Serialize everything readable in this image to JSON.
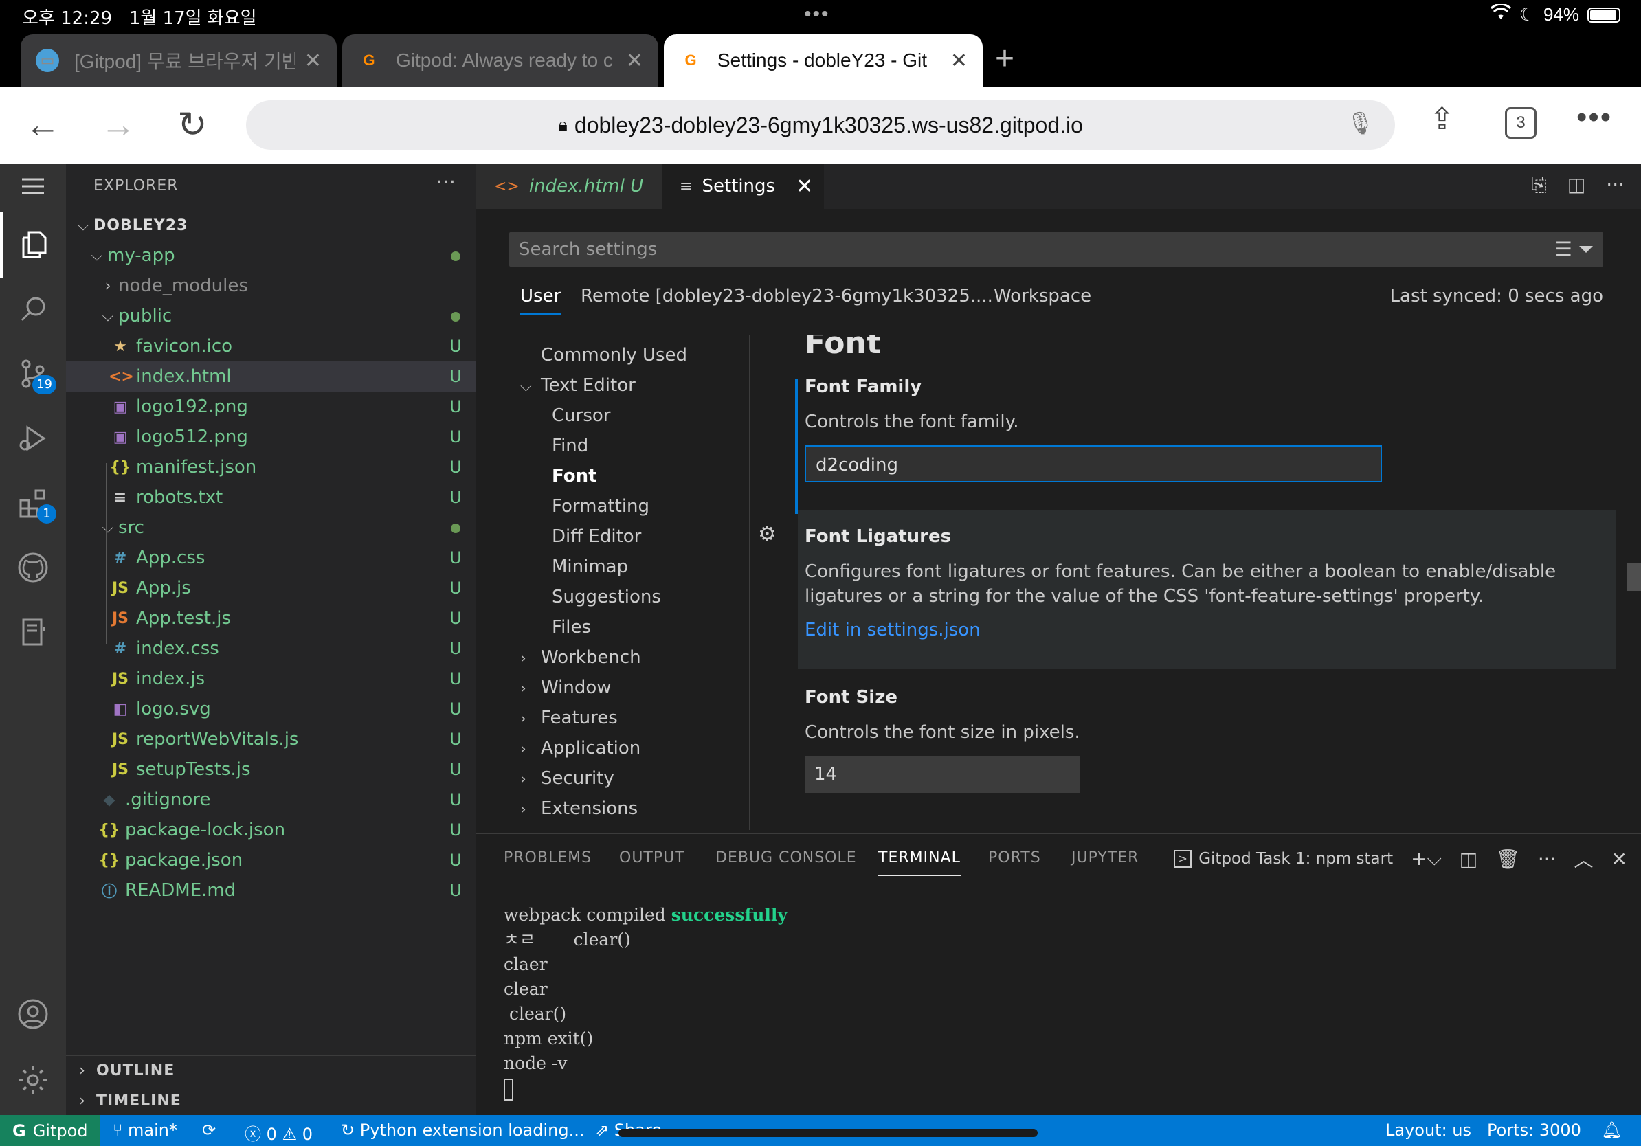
{
  "status_bar": {
    "time": "오후 12:29",
    "date": "1월 17일 화요일",
    "battery": "94%",
    "battery_level": 0.94
  },
  "browser": {
    "tabs": [
      {
        "label": "[Gitpod] 무료 브라우저 기반",
        "icon": "gitpod-monitor-icon",
        "active": false
      },
      {
        "label": "Gitpod: Always ready to c",
        "icon": "gitpod-logo-icon",
        "active": false
      },
      {
        "label": "Settings - dobleY23 - Git",
        "icon": "gitpod-logo-icon",
        "active": true
      }
    ],
    "url": "dobley23-dobley23-6gmy1k30325.ws-us82.gitpod.io",
    "tab_count": "3"
  },
  "explorer": {
    "title": "EXPLORER",
    "root": "DOBLEY23",
    "rows": [
      {
        "name": "my-app",
        "kind": "folder-open",
        "icon": "",
        "status": "dot",
        "color": "green",
        "indent": 1
      },
      {
        "name": "node_modules",
        "kind": "folder-closed",
        "icon": "",
        "status": "",
        "color": "grey",
        "indent": 2
      },
      {
        "name": "public",
        "kind": "folder-open",
        "icon": "",
        "status": "dot",
        "color": "green",
        "indent": 2
      },
      {
        "name": "favicon.ico",
        "kind": "file",
        "icon": "★",
        "iconColor": "#e5c07b",
        "status": "U",
        "color": "green",
        "indent": 3
      },
      {
        "name": "index.html",
        "kind": "file",
        "icon": "<>",
        "iconColor": "#e37933",
        "status": "U",
        "color": "green",
        "indent": 3,
        "selected": true
      },
      {
        "name": "logo192.png",
        "kind": "file",
        "icon": "▣",
        "iconColor": "#a074c4",
        "status": "U",
        "color": "green",
        "indent": 3
      },
      {
        "name": "logo512.png",
        "kind": "file",
        "icon": "▣",
        "iconColor": "#a074c4",
        "status": "U",
        "color": "green",
        "indent": 3
      },
      {
        "name": "manifest.json",
        "kind": "file",
        "icon": "{}",
        "iconColor": "#cbcb41",
        "status": "U",
        "color": "green",
        "indent": 3
      },
      {
        "name": "robots.txt",
        "kind": "file",
        "icon": "≡",
        "iconColor": "#cccccc",
        "status": "U",
        "color": "green",
        "indent": 3
      },
      {
        "name": "src",
        "kind": "folder-open",
        "icon": "",
        "status": "dot",
        "color": "green",
        "indent": 2
      },
      {
        "name": "App.css",
        "kind": "file",
        "icon": "#",
        "iconColor": "#519aba",
        "status": "U",
        "color": "green",
        "indent": 3
      },
      {
        "name": "App.js",
        "kind": "file",
        "icon": "JS",
        "iconColor": "#cbcb41",
        "status": "U",
        "color": "green",
        "indent": 3
      },
      {
        "name": "App.test.js",
        "kind": "file",
        "icon": "JS",
        "iconColor": "#e37933",
        "status": "U",
        "color": "green",
        "indent": 3
      },
      {
        "name": "index.css",
        "kind": "file",
        "icon": "#",
        "iconColor": "#519aba",
        "status": "U",
        "color": "green",
        "indent": 3
      },
      {
        "name": "index.js",
        "kind": "file",
        "icon": "JS",
        "iconColor": "#cbcb41",
        "status": "U",
        "color": "green",
        "indent": 3
      },
      {
        "name": "logo.svg",
        "kind": "file",
        "icon": "◧",
        "iconColor": "#a074c4",
        "status": "U",
        "color": "green",
        "indent": 3
      },
      {
        "name": "reportWebVitals.js",
        "kind": "file",
        "icon": "JS",
        "iconColor": "#cbcb41",
        "status": "U",
        "color": "green",
        "indent": 3
      },
      {
        "name": "setupTests.js",
        "kind": "file",
        "icon": "JS",
        "iconColor": "#cbcb41",
        "status": "U",
        "color": "green",
        "indent": 3
      },
      {
        "name": ".gitignore",
        "kind": "file",
        "icon": "◆",
        "iconColor": "#41535b",
        "status": "U",
        "color": "green",
        "indent": 2
      },
      {
        "name": "package-lock.json",
        "kind": "file",
        "icon": "{}",
        "iconColor": "#cbcb41",
        "status": "U",
        "color": "green",
        "indent": 2
      },
      {
        "name": "package.json",
        "kind": "file",
        "icon": "{}",
        "iconColor": "#cbcb41",
        "status": "U",
        "color": "green",
        "indent": 2
      },
      {
        "name": "README.md",
        "kind": "file",
        "icon": "ⓘ",
        "iconColor": "#519aba",
        "status": "U",
        "color": "green",
        "indent": 2
      }
    ],
    "outline": "OUTLINE",
    "timeline": "TIMELINE"
  },
  "activity_badges": {
    "scm": "19",
    "extensions": "1"
  },
  "editor_tabs": [
    {
      "label": "index.html",
      "suffix": "U"
    },
    {
      "label": "Settings"
    }
  ],
  "settings": {
    "search_placeholder": "Search settings",
    "scope_tabs": [
      "User",
      "Remote [dobley23-dobley23-6gmy1k30325....",
      "Workspace"
    ],
    "last_synced": "Last synced: 0 secs ago",
    "toc": [
      {
        "label": "Commonly Used",
        "level": 0,
        "chev": ""
      },
      {
        "label": "Text Editor",
        "level": 0,
        "chev": "open"
      },
      {
        "label": "Cursor",
        "level": 1,
        "chev": ""
      },
      {
        "label": "Find",
        "level": 1,
        "chev": ""
      },
      {
        "label": "Font",
        "level": 1,
        "chev": "",
        "bold": true
      },
      {
        "label": "Formatting",
        "level": 1,
        "chev": ""
      },
      {
        "label": "Diff Editor",
        "level": 1,
        "chev": ""
      },
      {
        "label": "Minimap",
        "level": 1,
        "chev": ""
      },
      {
        "label": "Suggestions",
        "level": 1,
        "chev": ""
      },
      {
        "label": "Files",
        "level": 1,
        "chev": ""
      },
      {
        "label": "Workbench",
        "level": 0,
        "chev": "closed"
      },
      {
        "label": "Window",
        "level": 0,
        "chev": "closed"
      },
      {
        "label": "Features",
        "level": 0,
        "chev": "closed"
      },
      {
        "label": "Application",
        "level": 0,
        "chev": "closed"
      },
      {
        "label": "Security",
        "level": 0,
        "chev": "closed"
      },
      {
        "label": "Extensions",
        "level": 0,
        "chev": "closed"
      }
    ],
    "section_title": "Font",
    "font_family": {
      "name": "Font Family",
      "desc": "Controls the font family.",
      "value": "d2coding"
    },
    "font_ligatures": {
      "name": "Font Ligatures",
      "desc": "Configures font ligatures or font features. Can be either a boolean to enable/disable ligatures or a string for the value of the CSS 'font-feature-settings' property.",
      "link": "Edit in settings.json"
    },
    "font_size": {
      "name": "Font Size",
      "desc": "Controls the font size in pixels.",
      "value": "14"
    }
  },
  "panel": {
    "tabs": [
      "PROBLEMS",
      "OUTPUT",
      "DEBUG CONSOLE",
      "TERMINAL",
      "PORTS",
      "JUPYTER"
    ],
    "active_tab": "TERMINAL",
    "task": "Gitpod Task 1: npm start",
    "terminal": {
      "line1_prefix": "webpack compiled ",
      "line1_ok": "successfully",
      "lines": [
        "ㅊㄹ       clear()",
        "claer",
        "clear",
        " clear()",
        "npm exit()",
        "node -v"
      ]
    }
  },
  "statusbar": {
    "remote": "Gitpod",
    "branch": "main*",
    "errors": "0",
    "warnings": "0",
    "python": "Python extension loading...",
    "share": "Share",
    "layout": "Layout: us",
    "ports": "Ports: 3000"
  },
  "colors": {
    "accent": "#0078d4",
    "remote_bg": "#16825d",
    "untracked": "#73c991",
    "terminal_success": "#23d18b"
  }
}
